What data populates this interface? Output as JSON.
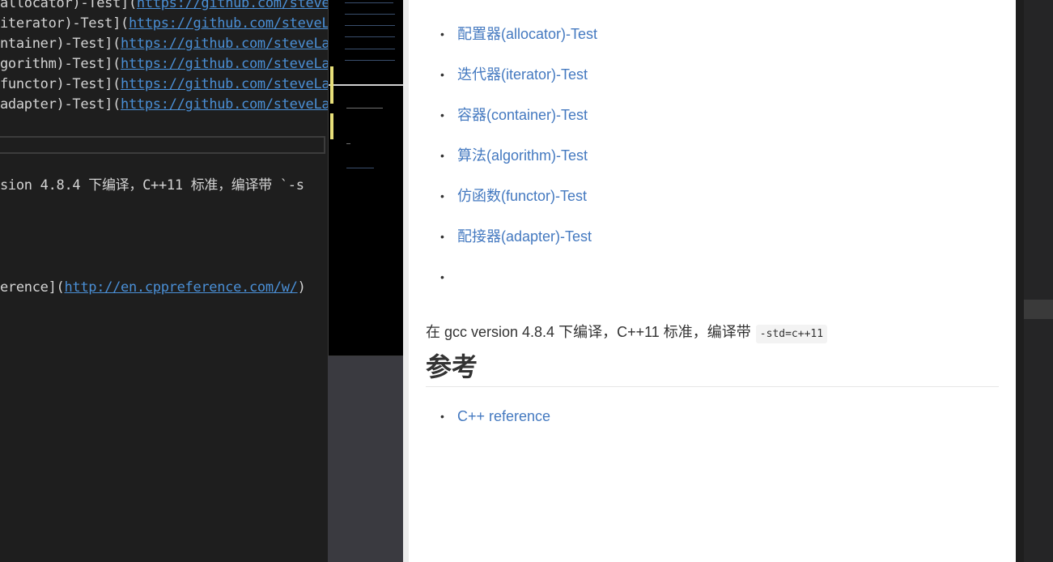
{
  "editor": {
    "lines": [
      {
        "pre": "allocator)-Test](",
        "url": "https://github.com/steve"
      },
      {
        "pre": "iterator)-Test](",
        "url": "https://github.com/steveL"
      },
      {
        "pre": "ntainer)-Test](",
        "url": "https://github.com/steveLa"
      },
      {
        "pre": "gorithm)-Test](",
        "url": "https://github.com/steveLa"
      },
      {
        "pre": "functor)-Test](",
        "url": "https://github.com/steveLa"
      },
      {
        "pre": "adapter)-Test](",
        "url": "https://github.com/steveLa"
      }
    ],
    "build_line": "sion 4.8.4 下编译，C++11 标准，编译带 `-s",
    "ref_line": {
      "pre": "erence](",
      "url": "http://en.cppreference.com/w/",
      "post": ")"
    }
  },
  "preview": {
    "list_items": [
      "配置器(allocator)-Test",
      "迭代器(iterator)-Test",
      "容器(container)-Test",
      "算法(algorithm)-Test",
      "仿函数(functor)-Test",
      "配接器(adapter)-Test",
      ""
    ],
    "bullet": "•",
    "build_text": "在 gcc version 4.8.4 下编译，C++11 标准，编译带",
    "build_code": "-std=c++11",
    "ref_heading": "参考",
    "ref_items": [
      "C++ reference"
    ]
  },
  "colors": {
    "link": "#4479c0",
    "editor_bg": "#1e1e1e",
    "editor_link": "#4a8fd6"
  }
}
